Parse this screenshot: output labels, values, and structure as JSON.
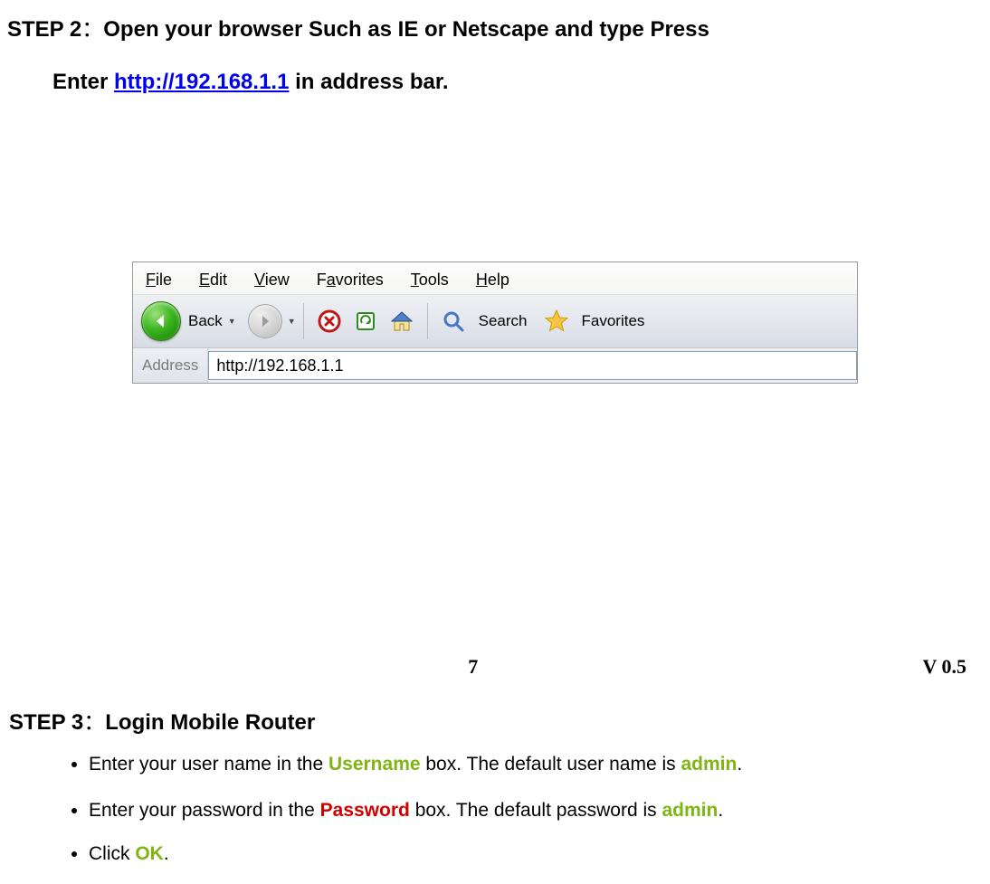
{
  "step2": {
    "prefix": "STEP 2",
    "colon": "：",
    "line1_rest": "Open your browser Such as IE or Netscape and type Press",
    "line2_pre": "Enter ",
    "url": "http://192.168.1.1",
    "line2_post": "   in address bar."
  },
  "browser": {
    "menu": {
      "file": "File",
      "edit": "Edit",
      "view": "View",
      "favorites": "Favorites",
      "tools": "Tools",
      "help": "Help"
    },
    "toolbar": {
      "back": "Back",
      "search": "Search",
      "favorites": "Favorites"
    },
    "address_label": "Address",
    "address_value": "http://192.168.1.1"
  },
  "footer": {
    "page": "7",
    "version": "V 0.5"
  },
  "step3": {
    "prefix": "STEP 3",
    "colon": "：",
    "title": "Login Mobile Router",
    "b1_pre": "Enter your user name in the ",
    "b1_field": "Username",
    "b1_mid": " box. The default user name is ",
    "b1_val": "admin",
    "b2_pre": "Enter your password in the ",
    "b2_field": "Password",
    "b2_mid": " box. The default password is ",
    "b2_val": "admin",
    "b3_pre": "Click ",
    "b3_val": "OK",
    "period": "."
  }
}
